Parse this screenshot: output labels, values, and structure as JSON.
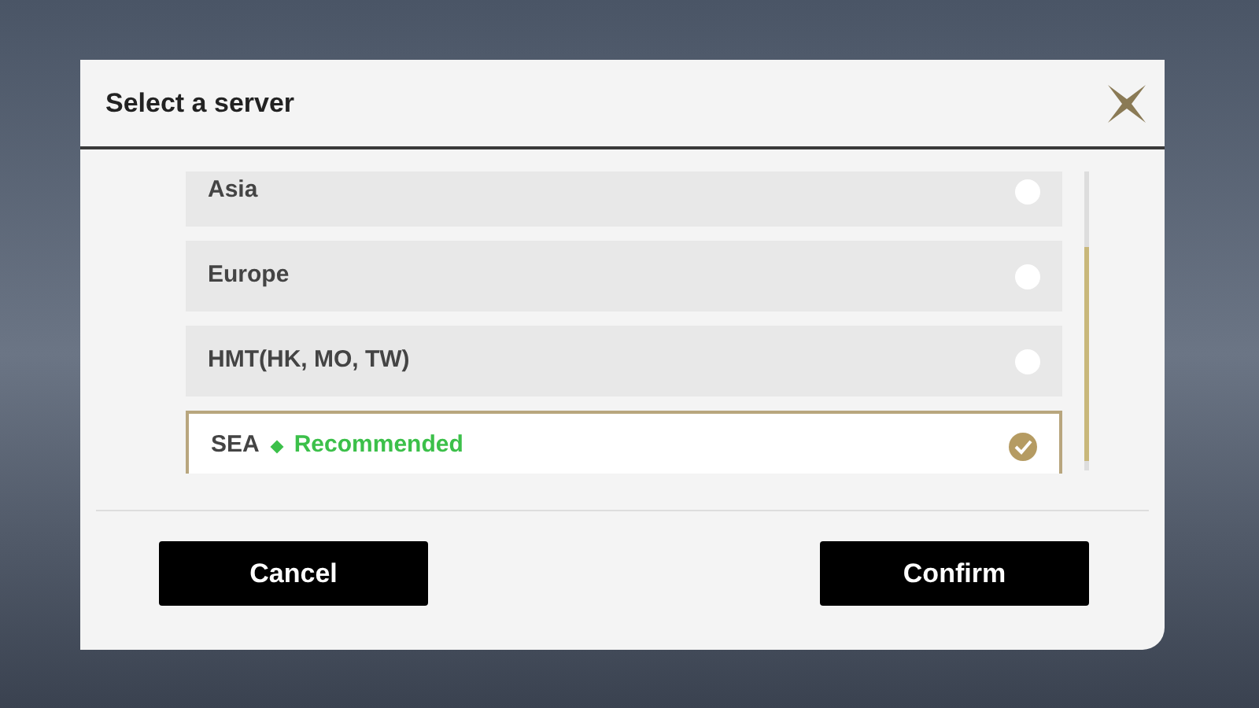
{
  "dialog": {
    "title": "Select a server"
  },
  "servers": [
    {
      "name": "Asia",
      "selected": false
    },
    {
      "name": "Europe",
      "selected": false
    },
    {
      "name": "HMT(HK, MO, TW)",
      "selected": false
    },
    {
      "name": "SEA",
      "tag": "Recommended",
      "selected": true
    }
  ],
  "buttons": [
    "Cancel",
    "Confirm"
  ]
}
